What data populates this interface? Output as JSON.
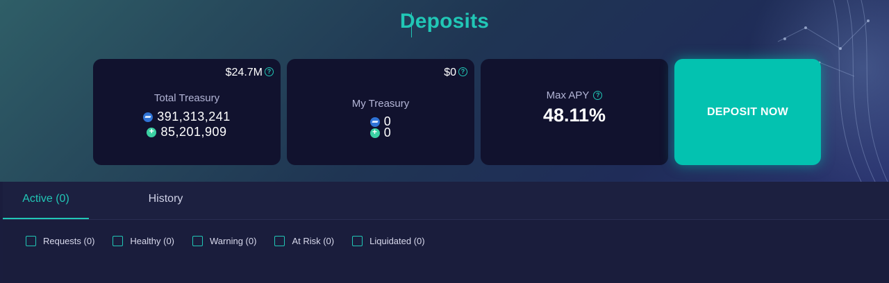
{
  "header": {
    "title": "Deposits"
  },
  "cards": {
    "total_treasury": {
      "usd_value": "$24.7M",
      "label": "Total Treasury",
      "token_a_amount": "391,313,241",
      "token_b_amount": "85,201,909"
    },
    "my_treasury": {
      "usd_value": "$0",
      "label": "My Treasury",
      "token_a_amount": "0",
      "token_b_amount": "0"
    },
    "max_apy": {
      "label": "Max APY",
      "value": "48.11%"
    }
  },
  "deposit_button": {
    "label": "DEPOSIT NOW"
  },
  "tabs": [
    {
      "label": "Active (0)",
      "active": true
    },
    {
      "label": "History",
      "active": false
    }
  ],
  "filters": [
    {
      "label": "Requests (0)",
      "checked": false
    },
    {
      "label": "Healthy (0)",
      "checked": false
    },
    {
      "label": "Warning (0)",
      "checked": false
    },
    {
      "label": "At Risk (0)",
      "checked": false
    },
    {
      "label": "Liquidated (0)",
      "checked": false
    }
  ],
  "colors": {
    "accent": "#21c7b6",
    "button": "#03c2b0",
    "card_bg": "#11122e",
    "panel_bg": "#1a1d3c"
  },
  "icons": {
    "help": "help-circle-icon",
    "token_a": "token-a-icon",
    "token_b": "token-b-icon"
  }
}
